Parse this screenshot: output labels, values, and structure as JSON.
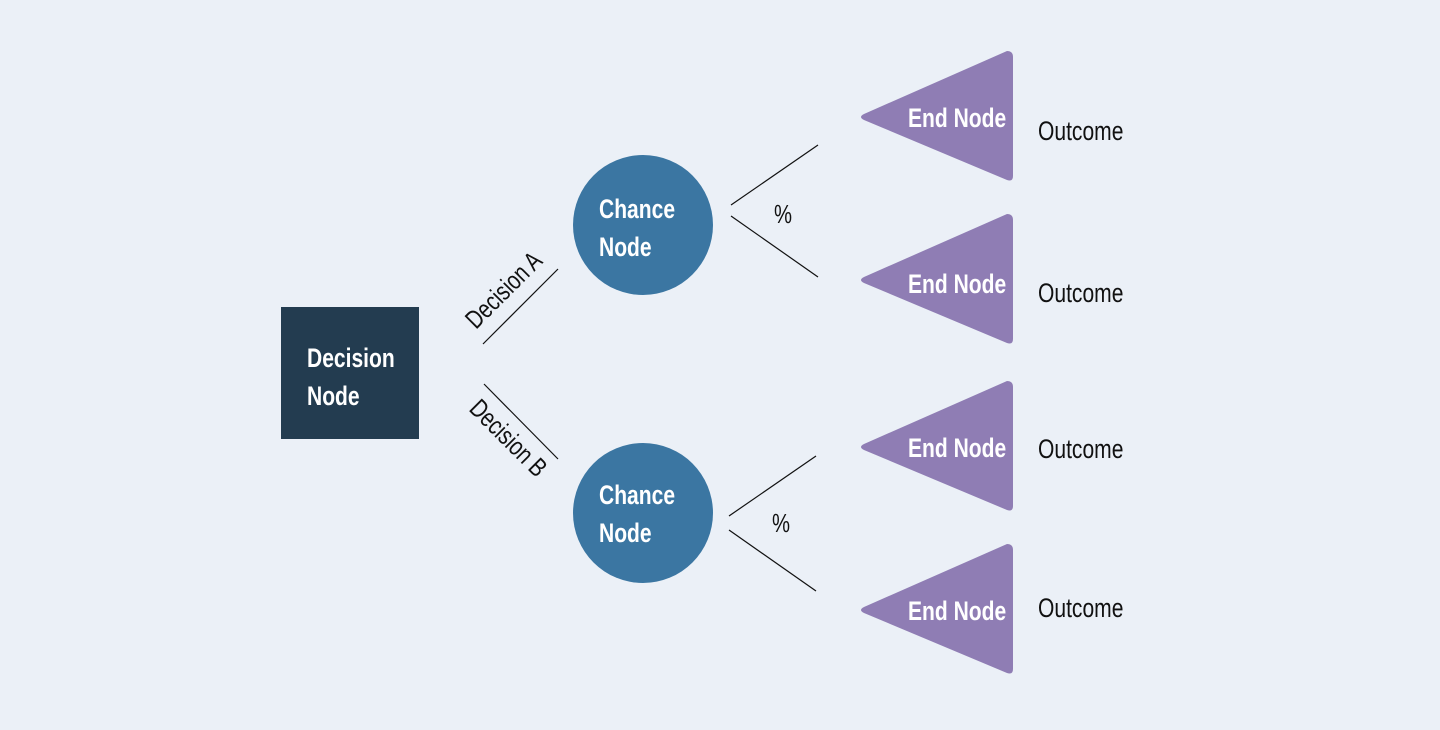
{
  "colors": {
    "background": "#ebf0f7",
    "decision": "#233c50",
    "chance": "#3b76a2",
    "end": "#8f7db4",
    "line": "#111111"
  },
  "decision_node": {
    "line1": "Decision",
    "line2": "Node"
  },
  "branches": [
    {
      "label": "Decision A",
      "chance": {
        "line1": "Chance",
        "line2": "Node"
      },
      "probability_label": "%",
      "ends": [
        {
          "label": "End Node",
          "outcome": "Outcome"
        },
        {
          "label": "End Node",
          "outcome": "Outcome"
        }
      ]
    },
    {
      "label": "Decision B",
      "chance": {
        "line1": "Chance",
        "line2": "Node"
      },
      "probability_label": "%",
      "ends": [
        {
          "label": "End Node",
          "outcome": "Outcome"
        },
        {
          "label": "End Node",
          "outcome": "Outcome"
        }
      ]
    }
  ]
}
